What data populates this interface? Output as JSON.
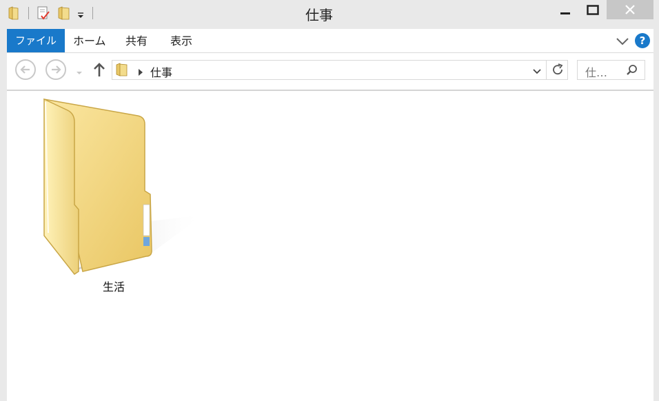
{
  "window": {
    "title": "仕事"
  },
  "ribbon": {
    "file_tab": "ファイル",
    "tabs": [
      "ホーム",
      "共有",
      "表示"
    ],
    "help": "?"
  },
  "address": {
    "path": [
      "仕事"
    ],
    "search_placeholder": "仕…"
  },
  "items": [
    {
      "name": "生活",
      "type": "folder"
    }
  ],
  "colors": {
    "accent": "#1979ca",
    "folder": "#f2d77e"
  }
}
